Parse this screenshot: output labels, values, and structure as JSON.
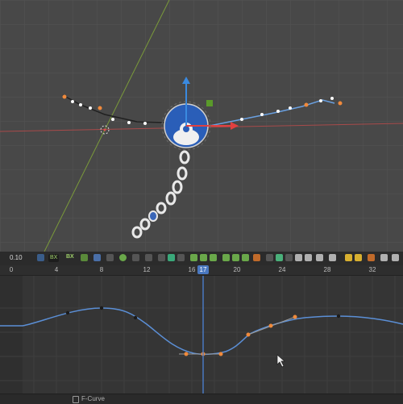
{
  "viewport": {
    "scene": "3D viewport with chain rig",
    "path_end_label_left": "",
    "path_end_label_right": ""
  },
  "timeline": {
    "value_readout": "0.10",
    "dropdown_value": "BX",
    "mode_label": "BX",
    "current_frame": "17",
    "ruler_ticks": [
      "0",
      "4",
      "8",
      "12",
      "16",
      "20",
      "24",
      "28",
      "32"
    ]
  },
  "status": {
    "panel_label": "F-Curve"
  },
  "colors": {
    "accent": "#4a78c0",
    "curve": "#5b8fd6",
    "key_selected": "#f08a3c",
    "key_normal": "#1b1b1b",
    "green": "#7fbf3f"
  }
}
